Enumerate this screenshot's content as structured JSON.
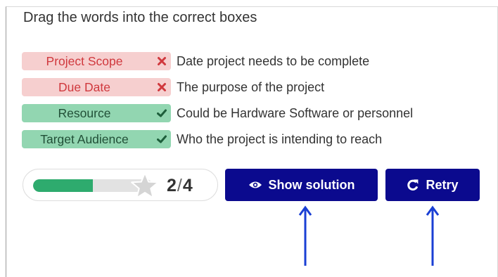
{
  "task": {
    "title": "Drag the words into the correct boxes"
  },
  "pairs": [
    {
      "word": "Project Scope",
      "definition": "Date project needs to be complete",
      "status": "wrong"
    },
    {
      "word": "Due Date",
      "definition": "The purpose of the project",
      "status": "wrong"
    },
    {
      "word": "Resource",
      "definition": "Could be Hardware Software or personnel",
      "status": "correct"
    },
    {
      "word": "Target Audience",
      "definition": "Who the project is intending to reach",
      "status": "correct"
    }
  ],
  "score": {
    "earned": "2",
    "separator": "/",
    "total": "4",
    "progress_fraction": 0.5
  },
  "buttons": {
    "show_solution": {
      "label": "Show solution",
      "icon": "eye-icon"
    },
    "retry": {
      "label": "Retry",
      "icon": "retry-icon"
    }
  },
  "colors": {
    "wrong_bg": "#f6cfcf",
    "wrong_text": "#d0383d",
    "correct_bg": "#92d6b1",
    "correct_text": "#214f37",
    "button_bg": "#0b0a8e",
    "progress_fill": "#2eab6e",
    "arrow": "#1a3fd4"
  }
}
